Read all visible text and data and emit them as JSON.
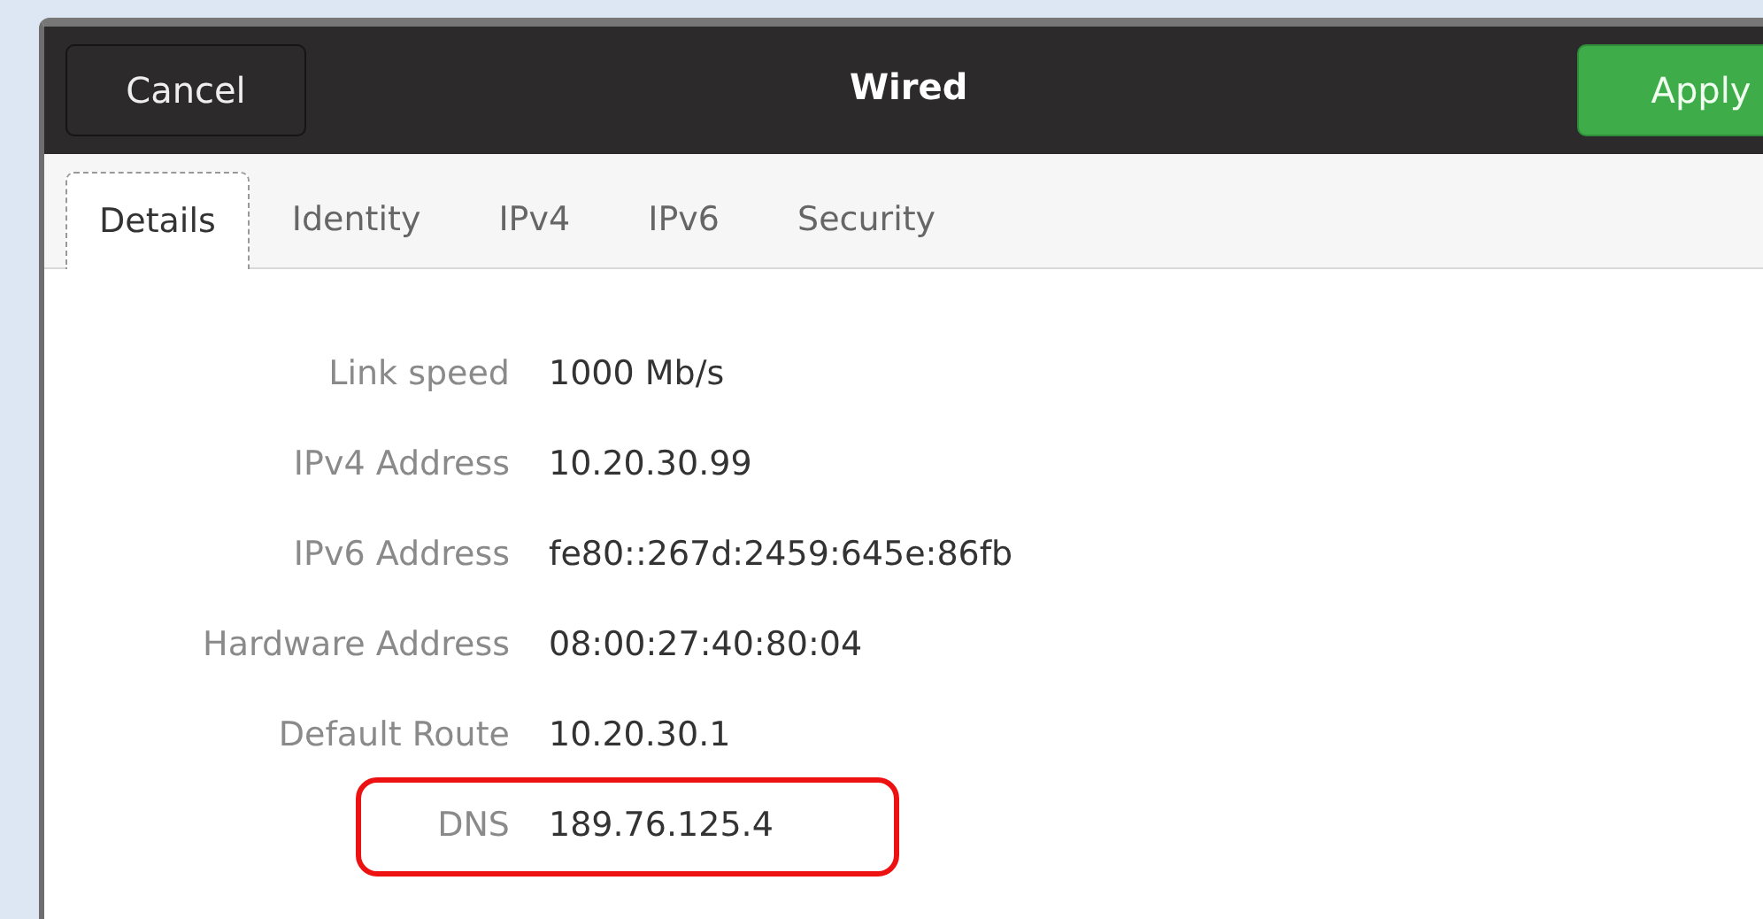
{
  "window": {
    "title": "Wired"
  },
  "header_buttons": [
    {
      "label": "Cancel",
      "kind": "plain"
    },
    {
      "label": "Apply",
      "kind": "suggested"
    }
  ],
  "tabs": [
    {
      "label": "Details",
      "selected": true
    },
    {
      "label": "Identity",
      "selected": false
    },
    {
      "label": "IPv4",
      "selected": false
    },
    {
      "label": "IPv6",
      "selected": false
    },
    {
      "label": "Security",
      "selected": false
    }
  ],
  "details": [
    {
      "label": "Link speed",
      "value": "1000 Mb/s",
      "highlighted": false
    },
    {
      "label": "IPv4 Address",
      "value": "10.20.30.99",
      "highlighted": false
    },
    {
      "label": "IPv6 Address",
      "value": "fe80::267d:2459:645e:86fb",
      "highlighted": false
    },
    {
      "label": "Hardware Address",
      "value": "08:00:27:40:80:04",
      "highlighted": false
    },
    {
      "label": "Default Route",
      "value": "10.20.30.1",
      "highlighted": false
    },
    {
      "label": "DNS",
      "value": "189.76.125.4",
      "highlighted": true
    }
  ]
}
